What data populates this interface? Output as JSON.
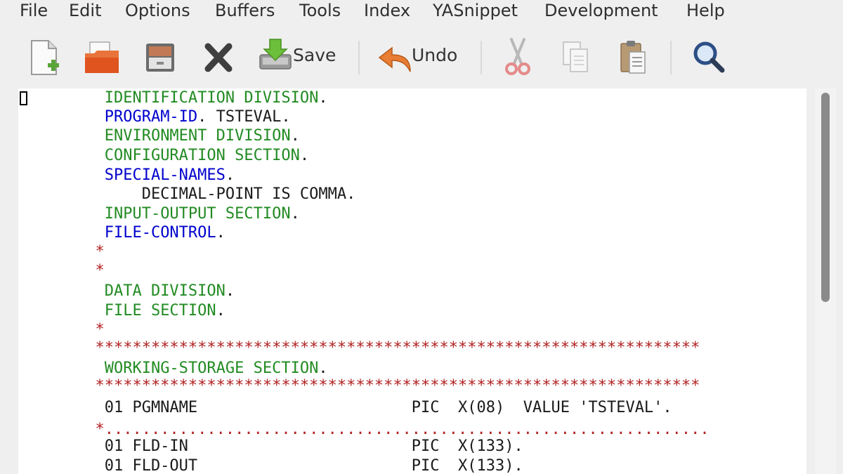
{
  "menu": [
    "File",
    "Edit",
    "Options",
    "Buffers",
    "Tools",
    "Index",
    "YASnippet",
    "Development",
    "Help"
  ],
  "toolbar": {
    "new_file": "new-file-icon",
    "open_file": "open-folder-icon",
    "dired": "file-cabinet-icon",
    "kill_buffer": "close-x-icon",
    "save_label": "Save",
    "undo_label": "Undo",
    "cut": "scissors-icon",
    "copy": "copy-icon",
    "paste": "paste-icon",
    "search": "magnifier-icon"
  },
  "colors": {
    "keyword_green": "#228b22",
    "keyword_blue": "#0000cd",
    "comment_red": "#b22222",
    "text": "#1a1a1a"
  },
  "editor": {
    "lines": [
      [
        {
          "t": "       ",
          "c": "plain"
        },
        {
          "t": "IDENTIFICATION DIVISION",
          "c": "kw-green"
        },
        {
          "t": ".",
          "c": "plain"
        }
      ],
      [
        {
          "t": "       ",
          "c": "plain"
        },
        {
          "t": "PROGRAM-ID",
          "c": "kw-blue"
        },
        {
          "t": ". TSTEVAL.",
          "c": "plain"
        }
      ],
      [
        {
          "t": "       ",
          "c": "plain"
        },
        {
          "t": "ENVIRONMENT DIVISION",
          "c": "kw-green"
        },
        {
          "t": ".",
          "c": "plain"
        }
      ],
      [
        {
          "t": "       ",
          "c": "plain"
        },
        {
          "t": "CONFIGURATION SECTION",
          "c": "kw-green"
        },
        {
          "t": ".",
          "c": "plain"
        }
      ],
      [
        {
          "t": "       ",
          "c": "plain"
        },
        {
          "t": "SPECIAL-NAMES",
          "c": "kw-blue"
        },
        {
          "t": ".",
          "c": "plain"
        }
      ],
      [
        {
          "t": "           DECIMAL-POINT IS COMMA.",
          "c": "plain"
        }
      ],
      [
        {
          "t": "       ",
          "c": "plain"
        },
        {
          "t": "INPUT-OUTPUT SECTION",
          "c": "kw-green"
        },
        {
          "t": ".",
          "c": "plain"
        }
      ],
      [
        {
          "t": "       ",
          "c": "plain"
        },
        {
          "t": "FILE-CONTROL",
          "c": "kw-blue"
        },
        {
          "t": ".",
          "c": "plain"
        }
      ],
      [
        {
          "t": "      *",
          "c": "cm-red"
        }
      ],
      [
        {
          "t": "      *",
          "c": "cm-red"
        }
      ],
      [
        {
          "t": "       ",
          "c": "plain"
        },
        {
          "t": "DATA DIVISION",
          "c": "kw-green"
        },
        {
          "t": ".",
          "c": "plain"
        }
      ],
      [
        {
          "t": "       ",
          "c": "plain"
        },
        {
          "t": "FILE SECTION",
          "c": "kw-green"
        },
        {
          "t": ".",
          "c": "plain"
        }
      ],
      [
        {
          "t": "      *",
          "c": "cm-red"
        }
      ],
      [
        {
          "t": "      *****************************************************************",
          "c": "cm-red"
        }
      ],
      [
        {
          "t": "       ",
          "c": "plain"
        },
        {
          "t": "WORKING-STORAGE SECTION",
          "c": "kw-green"
        },
        {
          "t": ".",
          "c": "plain"
        }
      ],
      [
        {
          "t": "      *****************************************************************",
          "c": "cm-red"
        }
      ],
      [
        {
          "t": "       01 PGMNAME                       PIC  X(08)  VALUE 'TSTEVAL'.",
          "c": "plain"
        }
      ],
      [
        {
          "t": "      *.................................................................",
          "c": "cm-red"
        }
      ],
      [
        {
          "t": "       01 FLD-IN                        PIC  X(133).",
          "c": "plain"
        }
      ],
      [
        {
          "t": "       01 FLD-OUT                       PIC  X(133).",
          "c": "plain"
        }
      ]
    ],
    "line_tops": [
      0,
      27,
      54,
      82,
      110,
      137,
      165,
      192,
      219,
      246,
      275,
      303,
      330,
      356,
      385,
      410,
      441,
      472,
      496,
      524
    ]
  },
  "scrollbar": {
    "position_fraction": 0.0,
    "visible_fraction": 0.55
  }
}
